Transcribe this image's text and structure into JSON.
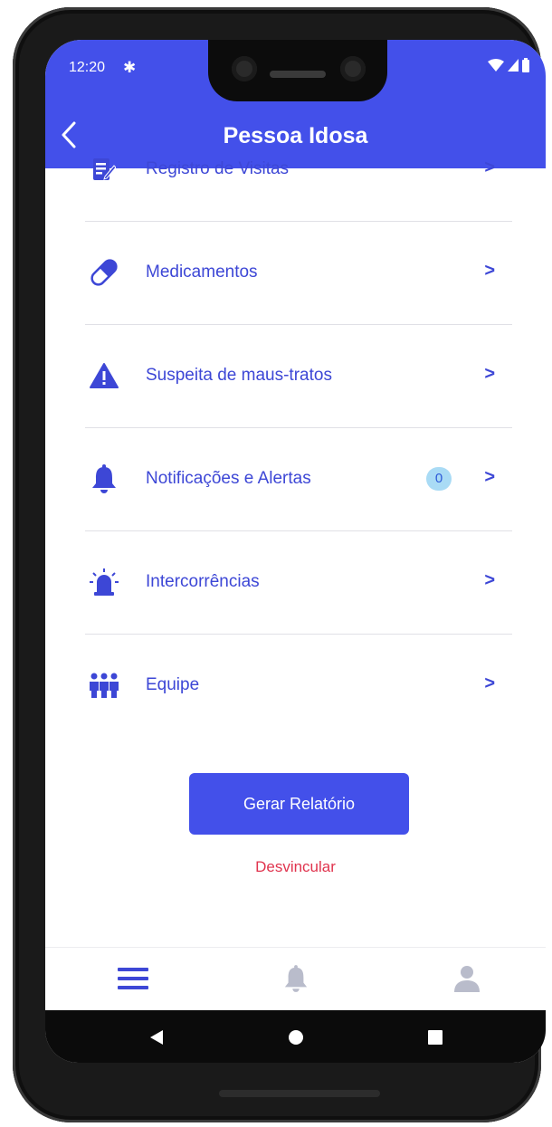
{
  "status_bar": {
    "time": "12:20"
  },
  "app_bar": {
    "title": "Pessoa Idosa"
  },
  "menu": {
    "items": [
      {
        "label": "Registro de Visitas",
        "icon": "clipboard-edit-icon"
      },
      {
        "label": "Medicamentos",
        "icon": "pill-icon"
      },
      {
        "label": "Suspeita de maus-tratos",
        "icon": "warning-icon"
      },
      {
        "label": "Notificações e Alertas",
        "icon": "bell-icon",
        "badge": "0"
      },
      {
        "label": "Intercorrências",
        "icon": "siren-icon"
      },
      {
        "label": "Equipe",
        "icon": "team-icon"
      }
    ],
    "chevron": ">"
  },
  "actions": {
    "report_label": "Gerar Relatório",
    "unlink_label": "Desvincular"
  },
  "tabbar": {
    "tabs": [
      {
        "icon": "menu-icon",
        "active": true
      },
      {
        "icon": "bell-icon",
        "active": false
      },
      {
        "icon": "user-icon",
        "active": false
      }
    ]
  },
  "colors": {
    "primary": "#4350ea",
    "link": "#3d47d6",
    "danger": "#e0344e",
    "inactive_tab": "#b9bccb",
    "badge_bg": "#a9dbf5"
  }
}
